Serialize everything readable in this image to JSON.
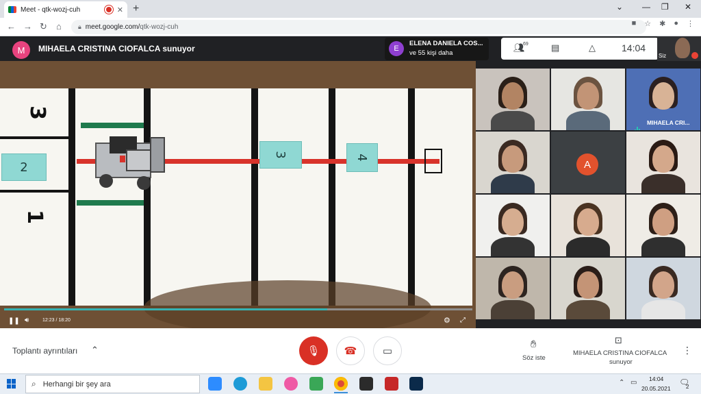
{
  "browser": {
    "tab_title": "Meet - qtk-wozj-cuh",
    "new_tab": "+",
    "url_host": "meet.google.com/",
    "url_path": "qtk-wozj-cuh"
  },
  "meeting": {
    "presenter_initial": "M",
    "presenter_banner": "MIHAELA CRISTINA CIOFALCA sunuyor",
    "other_presenter_initial": "E",
    "other_presenter_name": "ELENA DANIELA COS...",
    "other_presenter_more": "ve 55 kişi daha",
    "participant_count": "69",
    "time": "14:04",
    "self_label": "Siz"
  },
  "video": {
    "elapsed": "12:23",
    "duration": "18:20",
    "progress": 0.69,
    "mat_numbers": [
      "3",
      "1"
    ],
    "cube_labels": [
      "2",
      "3",
      "4"
    ]
  },
  "participants": [
    {
      "kind": "video",
      "name": ""
    },
    {
      "kind": "video",
      "name": ""
    },
    {
      "kind": "video",
      "name": "MIHAELA CRI..."
    },
    {
      "kind": "video",
      "name": ""
    },
    {
      "kind": "avatar",
      "initial": "A",
      "name": ""
    },
    {
      "kind": "video",
      "name": ""
    },
    {
      "kind": "video",
      "name": ""
    },
    {
      "kind": "video",
      "name": ""
    },
    {
      "kind": "video",
      "name": ""
    },
    {
      "kind": "video",
      "name": ""
    },
    {
      "kind": "video",
      "name": ""
    },
    {
      "kind": "video",
      "name": ""
    }
  ],
  "bottom": {
    "details_label": "Toplantı ayrıntıları",
    "raise_hand_label": "Söz iste",
    "presenting_name": "MIHAELA CRISTINA CIOFALCA",
    "presenting_sub": "sunuyor"
  },
  "taskbar": {
    "search_placeholder": "Herhangi bir şey ara",
    "clock_time": "14:04",
    "clock_date": "20.05.2021",
    "notification_count": "2"
  },
  "colors": {
    "meet_dark": "#202124",
    "hangup_red": "#d93025",
    "presenter_avatar": "#e8437e",
    "avatar_a": "#e2522d",
    "cube": "#8fd8d3"
  }
}
